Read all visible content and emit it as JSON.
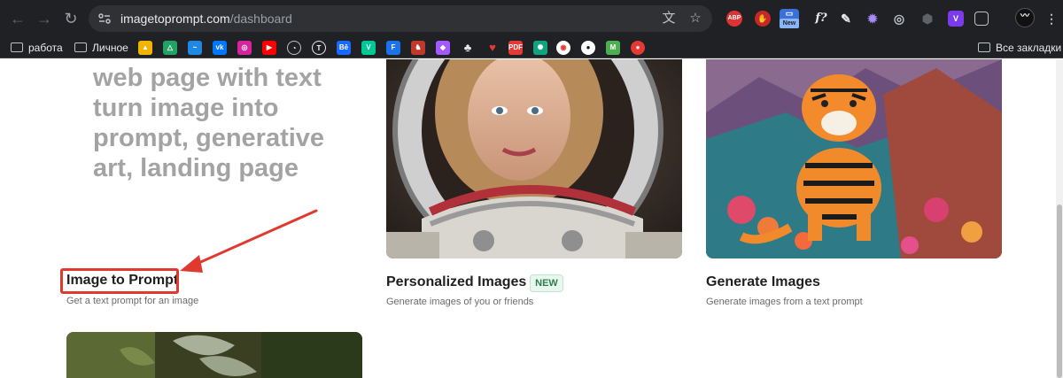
{
  "browser": {
    "url_host": "imagetoprompt.com",
    "url_path": "/dashboard",
    "colors": {
      "chrome": "#202124",
      "omnibox": "#303134"
    }
  },
  "bookmarks": {
    "folders": [
      "работа",
      "Личное"
    ],
    "all_bookmarks": "Все закладки"
  },
  "extensions": {
    "abp_label": "ABP",
    "new_badge": "New",
    "fx_label": "f?",
    "v_label": "V"
  },
  "hero": {
    "lines": [
      "web page with text",
      "turn image into",
      "prompt, generative",
      "art, landing page"
    ]
  },
  "cards": [
    {
      "title": "Image to Prompt",
      "subtitle": "Get a text prompt for an image"
    },
    {
      "title": "Personalized Images",
      "subtitle": "Generate images of you or friends",
      "badge": "NEW"
    },
    {
      "title": "Generate Images",
      "subtitle": "Generate images from a text prompt"
    }
  ],
  "annotation": {
    "color": "#e03a30"
  }
}
